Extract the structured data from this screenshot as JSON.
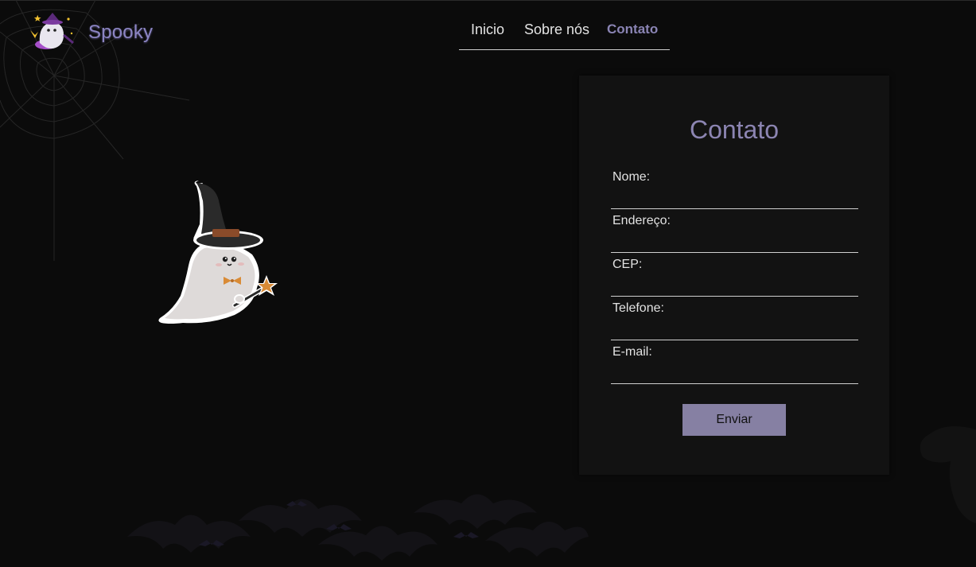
{
  "header": {
    "brand": "Spooky",
    "logo_icon": "witch-ghost-logo-icon",
    "nav": [
      {
        "label": "Inicio",
        "active": false
      },
      {
        "label": "Sobre nós",
        "active": false
      },
      {
        "label": "Contato",
        "active": true
      }
    ]
  },
  "hero": {
    "illustration": "witch-ghost-icon"
  },
  "form": {
    "title": "Contato",
    "fields": [
      {
        "label": "Nome:",
        "value": ""
      },
      {
        "label": "Endereço:",
        "value": ""
      },
      {
        "label": "CEP:",
        "value": ""
      },
      {
        "label": "Telefone:",
        "value": ""
      },
      {
        "label": "E-mail:",
        "value": ""
      }
    ],
    "submit_label": "Enviar"
  },
  "colors": {
    "background": "#0b0b0b",
    "card": "#121212",
    "accent": "#8c85c4",
    "button": "#8680a3"
  }
}
